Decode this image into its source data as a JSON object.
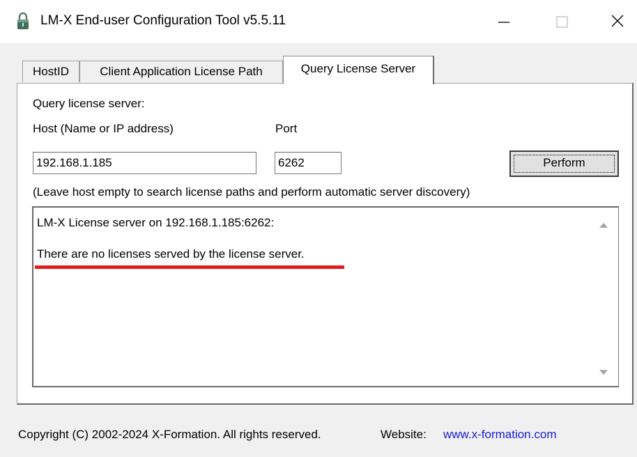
{
  "window": {
    "title": "LM-X End-user Configuration Tool v5.5.11"
  },
  "icons": {
    "app": "lock-icon",
    "minimize": "minimize-icon",
    "maximize": "maximize-icon",
    "close": "close-icon",
    "scroll_up": "scroll-up-arrow-icon",
    "scroll_down": "scroll-down-arrow-icon"
  },
  "tabs": [
    {
      "label": "HostID",
      "active": false
    },
    {
      "label": "Client Application License Path",
      "active": false
    },
    {
      "label": "Query License Server",
      "active": true
    }
  ],
  "query_panel": {
    "section_label": "Query license server:",
    "host_label": "Host (Name or IP address)",
    "port_label": "Port",
    "host_value": "192.168.1.185",
    "port_value": "6262",
    "perform_label": "Perform",
    "hint": "(Leave host empty to search license paths and perform automatic server discovery)",
    "output_lines": [
      "LM-X License server on 192.168.1.185:6262:",
      "There are no licenses served by the license server."
    ]
  },
  "footer": {
    "copyright": "Copyright (C) 2002-2024 X-Formation. All rights reserved.",
    "website_label": "Website:",
    "website_link": "www.x-formation.com"
  },
  "colors": {
    "highlight_underline": "#e02020",
    "link": "#1a1ae0"
  }
}
